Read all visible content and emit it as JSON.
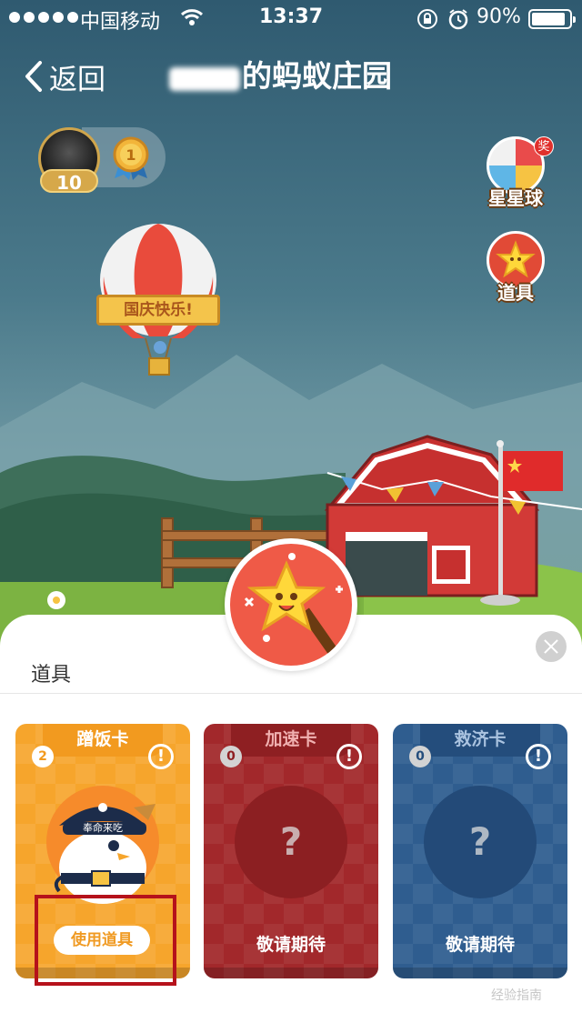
{
  "status_bar": {
    "carrier": "中国移动",
    "time": "13:37",
    "battery": "90%",
    "battery_level": 0.9
  },
  "nav": {
    "back_label": "返回",
    "title": "的蚂蚁庄园"
  },
  "user": {
    "level": "10",
    "medal_rank": "1"
  },
  "side_entries": {
    "star_ball": {
      "label": "星星球",
      "badge": "奖"
    },
    "props": {
      "label": "道具"
    }
  },
  "balloon": {
    "banner": "国庆快乐!"
  },
  "sheet": {
    "title": "道具",
    "cards": [
      {
        "name": "蹭饭卡",
        "count": "2",
        "info": "!",
        "hat_text": "奉命来吃",
        "action": "使用道具",
        "color": "#f6a52c"
      },
      {
        "name": "加速卡",
        "count": "0",
        "info": "!",
        "placeholder": "?",
        "status": "敬请期待",
        "color": "#a2282b"
      },
      {
        "name": "救济卡",
        "count": "0",
        "info": "!",
        "placeholder": "?",
        "status": "敬请期待",
        "color": "#2f5d8f"
      }
    ]
  },
  "watermark": "经验指南",
  "colors": {
    "highlight": "#b5121b",
    "accent_orange": "#f29a1f"
  }
}
